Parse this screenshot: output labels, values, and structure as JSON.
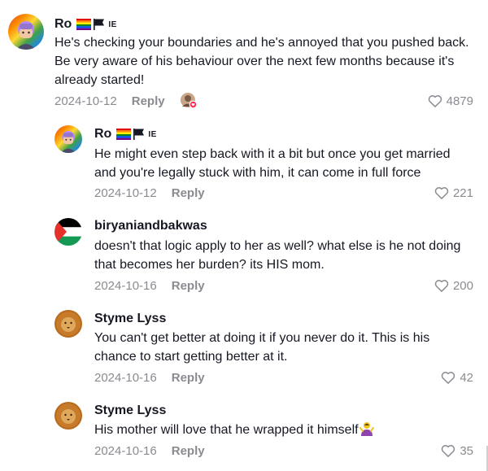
{
  "comments": [
    {
      "username": "Ro",
      "flag_text": "IE",
      "text_lines": [
        "He's checking your boundaries and he's annoyed that you pushed back.",
        "Be very aware of his behaviour over the next few months because it's",
        "already started!"
      ],
      "date": "2024-10-12",
      "reply_label": "Reply",
      "likes": "4879"
    },
    {
      "username": "Ro",
      "flag_text": "IE",
      "text_lines": [
        "He might even step back with it a bit but once you get married",
        "and you're legally stuck with him, it can come in full force"
      ],
      "date": "2024-10-12",
      "reply_label": "Reply",
      "likes": "221"
    },
    {
      "username": "biryaniandbakwas",
      "text_lines": [
        "doesn't that logic apply to her as well? what else is he not doing",
        "that becomes her burden? its HIS mom."
      ],
      "date": "2024-10-16",
      "reply_label": "Reply",
      "likes": "200"
    },
    {
      "username": "Styme Lyss",
      "text_lines": [
        "You can't get better at doing it if you never do it. This is his",
        "chance to start getting better at it."
      ],
      "date": "2024-10-16",
      "reply_label": "Reply",
      "likes": "42"
    },
    {
      "username": "Styme Lyss",
      "text_lines": [
        "His mother will love that he wrapped it himself"
      ],
      "date": "2024-10-16",
      "reply_label": "Reply",
      "likes": "35"
    }
  ],
  "icons": {
    "like": "heart-outline-icon",
    "creator_like": "creator-liked-avatar-icon",
    "emoji": "person-shrugging-emoji"
  },
  "colors": {
    "text": "#161823",
    "meta": "#8a8b91",
    "creator_badge": "#fe2c55"
  }
}
